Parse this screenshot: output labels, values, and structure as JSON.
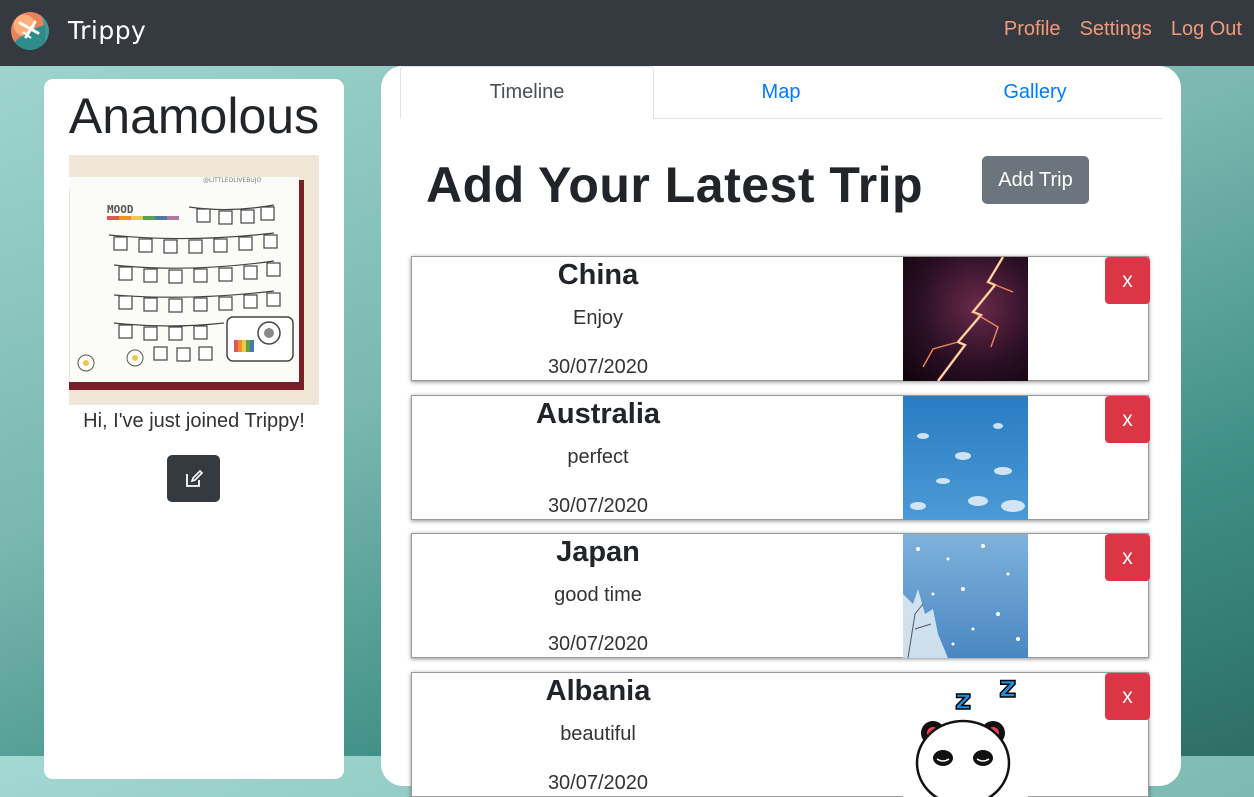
{
  "app": {
    "brand": "Trippy",
    "logo_icon": "globe-plane-logo-icon"
  },
  "nav": {
    "links": [
      "Profile",
      "Settings",
      "Log Out"
    ]
  },
  "profile": {
    "name": "Anamolous",
    "bio": "Hi, I've just joined Trippy!",
    "image_text": "MOOD",
    "image_watermark": "@LITTLEOLIVEBUJO",
    "edit_icon": "edit-icon"
  },
  "tabs": [
    {
      "label": "Timeline",
      "active": true
    },
    {
      "label": "Map",
      "active": false
    },
    {
      "label": "Gallery",
      "active": false
    }
  ],
  "main": {
    "headline": "Add Your Latest Trip",
    "add_button": "Add Trip"
  },
  "trips": [
    {
      "name": "China",
      "description": "Enjoy",
      "date": "30/07/2020",
      "image": "lightning-photo",
      "delete_label": "x"
    },
    {
      "name": "Australia",
      "description": "perfect",
      "date": "30/07/2020",
      "image": "blue-sky-photo",
      "delete_label": "x"
    },
    {
      "name": "Japan",
      "description": "good time",
      "date": "30/07/2020",
      "image": "snow-tree-photo",
      "delete_label": "x"
    },
    {
      "name": "Albania",
      "description": "beautiful",
      "date": "30/07/2020",
      "image": "sleeping-panda-sticker",
      "delete_label": "x"
    }
  ],
  "colors": {
    "navbar": "#343a40",
    "nav_link": "#f2997a",
    "tab_link": "#007bff",
    "delete": "#dc3545",
    "add_button": "#6c757d"
  }
}
